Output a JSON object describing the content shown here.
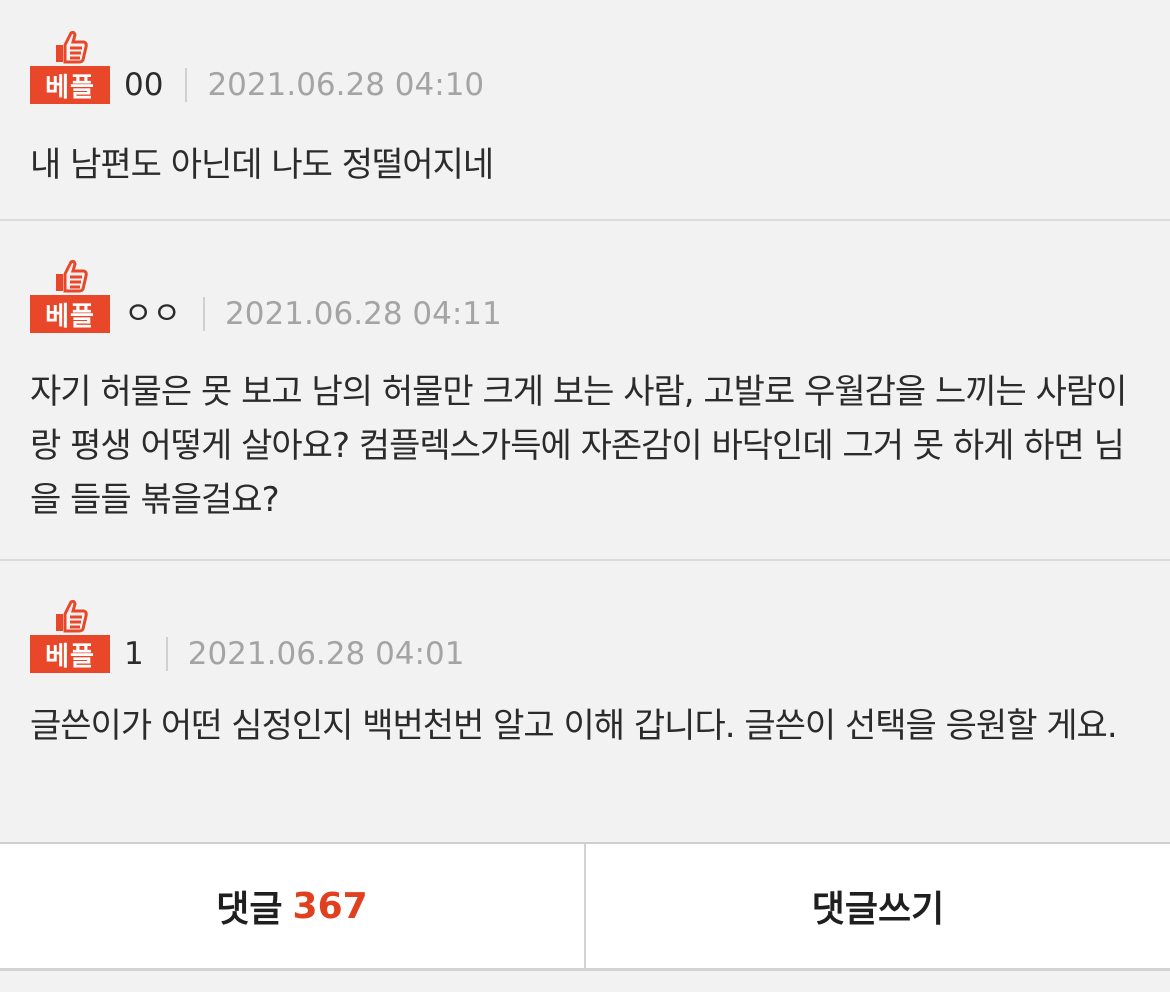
{
  "comments": [
    {
      "badge": "베플",
      "nickname": "00",
      "date": "2021.06.28 04:10",
      "text": "내 남편도 아닌데 나도 정떨어지네"
    },
    {
      "badge": "베플",
      "nickname": "ㅇㅇ",
      "date": "2021.06.28 04:11",
      "text": "자기 허물은 못 보고 남의 허물만 크게 보는 사람, 고발로 우월감을 느끼는 사람이랑 평생 어떻게 살아요? 컴플렉스가득에 자존감이 바닥인데 그거 못 하게 하면 님을 들들 볶을걸요?"
    },
    {
      "badge": "베플",
      "nickname": "1",
      "date": "2021.06.28 04:01",
      "text": "글쓴이가 어떤 심정인지 백번천번 알고 이해 갑니다. 글쓴이 선택을 응원할 게요."
    }
  ],
  "footer": {
    "comments_label": "댓글",
    "comments_count": "367",
    "write_label": "댓글쓰기"
  },
  "colors": {
    "accent": "#e8472a",
    "count": "#e0401f",
    "background": "#f2f2f2"
  },
  "icons": [
    "thumbs-up-icon"
  ]
}
